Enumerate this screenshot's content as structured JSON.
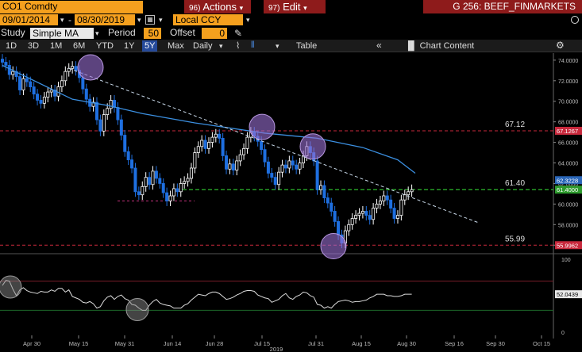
{
  "header": {
    "ticker": "CO1 Comdty",
    "actions_label": "Actions",
    "actions_num": "96)",
    "edit_label": "Edit",
    "edit_num": "97)",
    "page_title": "G 256: BEEF_FINMARKETS"
  },
  "range": {
    "start_date": "09/01/2014",
    "end_date": "08/30/2019",
    "currency": "Local CCY"
  },
  "study": {
    "label": "Study",
    "type": "Simple MA",
    "period_label": "Period",
    "period_value": "50",
    "offset_label": "Offset",
    "offset_value": "0"
  },
  "toolbar": {
    "periods": [
      "1D",
      "3D",
      "1M",
      "6M",
      "YTD",
      "1Y",
      "5Y",
      "Max"
    ],
    "active_period": "5Y",
    "frequency": "Daily",
    "table_label": "Table",
    "chart_content_label": "Chart Content"
  },
  "chart_data": {
    "type": "candlestick",
    "x_ticks": [
      "Apr 30",
      "May 15",
      "May 31",
      "Jun 14",
      "Jun 28",
      "Jul 15",
      "Jul 31",
      "Aug 15",
      "Aug 30",
      "Sep 16",
      "Sep 30",
      "Oct 15"
    ],
    "x_year": "2019",
    "y_ticks": [
      "74.0000",
      "72.0000",
      "70.0000",
      "68.0000",
      "66.0000",
      "64.0000",
      "62.0000",
      "60.0000",
      "58.0000",
      "56.0000"
    ],
    "ylim": [
      55.4,
      74.3
    ],
    "level_labels": [
      "67.12",
      "61.40",
      "55.99"
    ],
    "price_flags": [
      {
        "text": "67.1267",
        "value": 67.1267,
        "color": "#c8283c"
      },
      {
        "text": "62.3228",
        "value": 62.3228,
        "color": "#2a66b8"
      },
      {
        "text": "61.4000",
        "value": 61.4,
        "color": "#2d9a2d"
      },
      {
        "text": "55.9962",
        "value": 55.9962,
        "color": "#c8283c"
      }
    ],
    "close": [
      73.8,
      73.5,
      72.6,
      72.9,
      72.4,
      71.1,
      72.2,
      71.9,
      71.4,
      70.7,
      70.1,
      69.8,
      70.4,
      70.9,
      71.1,
      70.5,
      71.4,
      72.0,
      72.9,
      73.2,
      73.4,
      73.0,
      72.3,
      71.2,
      70.2,
      69.5,
      69.9,
      68.2,
      67.1,
      68.7,
      69.3,
      70.1,
      69.4,
      68.2,
      66.7,
      65.1,
      64.3,
      63.5,
      61.2,
      60.9,
      61.7,
      62.6,
      61.9,
      63.2,
      62.5,
      62.0,
      61.1,
      60.3,
      60.8,
      61.5,
      61.2,
      62.0,
      62.2,
      62.5,
      63.5,
      65.0,
      65.6,
      66.2,
      65.4,
      66.0,
      66.5,
      66.8,
      66.4,
      64.7,
      63.4,
      63.9,
      63.3,
      64.2,
      64.8,
      65.4,
      66.5,
      67.0,
      66.6,
      66.1,
      65.3,
      64.1,
      63.0,
      62.6,
      61.9,
      63.1,
      63.8,
      63.5,
      64.2,
      63.8,
      63.4,
      64.0,
      64.7,
      65.6,
      65.0,
      64.2,
      61.4,
      61.8,
      60.6,
      60.1,
      59.3,
      58.3,
      57.0,
      56.2,
      57.4,
      58.0,
      58.6,
      58.9,
      59.1,
      59.3,
      58.9,
      58.5,
      59.6,
      60.0,
      60.3,
      60.8,
      60.4,
      59.6,
      58.6,
      58.9,
      60.4,
      60.9,
      61.2,
      61.4
    ],
    "ma50_path": [
      [
        73.5,
        0
      ],
      [
        70.2,
        20
      ],
      [
        69.6,
        30
      ],
      [
        68.8,
        40
      ],
      [
        67.9,
        55
      ],
      [
        66.9,
        75
      ],
      [
        66.4,
        90
      ],
      [
        65.5,
        103
      ],
      [
        64.3,
        113
      ],
      [
        63.0,
        118
      ]
    ],
    "trendline": {
      "from": [
        73.2,
        19
      ],
      "to": [
        59.7,
        117
      ]
    },
    "support_60_3": 60.3,
    "oscillator": {
      "y_ticks": [
        "100",
        "50",
        "0"
      ],
      "last_value": "52.0439",
      "upper_band": 70,
      "lower_band": 30,
      "values": [
        64,
        71,
        70,
        59,
        50,
        58,
        61,
        57,
        55,
        54,
        53,
        56,
        55,
        55,
        58,
        56,
        60,
        60,
        55,
        58,
        49,
        47,
        45,
        41,
        40,
        42,
        39,
        33,
        35,
        43,
        48,
        50,
        45,
        49,
        51,
        46,
        44,
        38,
        37,
        33,
        30,
        30,
        37,
        42,
        45,
        40,
        38,
        37,
        36,
        33,
        33,
        33,
        37,
        39,
        44,
        48,
        52,
        51,
        50,
        53,
        55,
        55,
        53,
        49,
        45,
        46,
        48,
        51,
        53,
        56,
        57,
        57,
        56,
        51,
        49,
        47,
        46,
        41,
        43,
        45,
        50,
        53,
        47,
        45,
        49,
        51,
        55,
        54,
        50,
        48,
        38,
        37,
        33,
        35,
        33,
        38,
        42,
        43,
        44,
        43,
        41,
        42,
        42,
        43,
        44,
        47,
        49,
        52,
        52,
        52,
        50,
        50,
        49,
        49,
        50,
        52,
        52,
        52
      ]
    }
  },
  "colors": {
    "header_orange": "#f5a01e",
    "header_red": "#8e1b1b",
    "active_blue": "#254a9a",
    "candle_up": "#ffffff",
    "candle_down": "#1e6fe0",
    "ma_line": "#3b8fe0",
    "trend_line": "#c8d8e8",
    "support_green": "#2db82d",
    "resistance_red": "#c8283c",
    "highlight_circle": "#9a70d2"
  },
  "icons": [
    "search-icon",
    "down-arrow-icon",
    "pencil-icon",
    "line-chart-icon",
    "bar-chart-icon",
    "collapse-icon",
    "gear-icon"
  ]
}
